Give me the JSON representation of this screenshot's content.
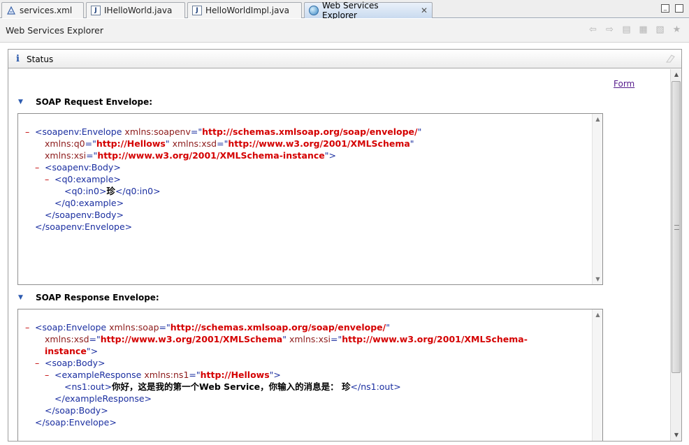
{
  "tabs": [
    {
      "label": "services.xml",
      "icon": "xml-file-icon",
      "active": false
    },
    {
      "label": "IHelloWorld.java",
      "icon": "java-file-icon",
      "active": false
    },
    {
      "label": "HelloWorldImpl.java",
      "icon": "java-file-icon",
      "active": false
    },
    {
      "label": "Web Services Explorer",
      "icon": "globe-icon",
      "active": true
    }
  ],
  "title": "Web Services Explorer",
  "status": {
    "label": "Status",
    "form_link": "Form",
    "request_title": "SOAP Request Envelope:",
    "response_title": "SOAP Response Envelope:"
  },
  "request": {
    "envelope_tag": "soapenv:Envelope",
    "attr_soapenv": "xmlns:soapenv",
    "val_soapenv": "http://schemas.xmlsoap.org/soap/envelope/",
    "attr_q0": "xmlns:q0",
    "val_q0": "http://Hellows",
    "attr_xsd": "xmlns:xsd",
    "val_xsd": "http://www.w3.org/2001/XMLSchema",
    "attr_xsi": "xmlns:xsi",
    "val_xsi": "http://www.w3.org/2001/XMLSchema-instance",
    "body_tag": "soapenv:Body",
    "example_tag": "q0:example",
    "in_tag": "q0:in0",
    "in_value": "珍"
  },
  "response": {
    "envelope_tag": "soap:Envelope",
    "attr_soap": "xmlns:soap",
    "val_soap": "http://schemas.xmlsoap.org/soap/envelope/",
    "attr_xsd": "xmlns:xsd",
    "val_xsd": "http://www.w3.org/2001/XMLSchema",
    "attr_xsi": "xmlns:xsi",
    "val_xsi_1": "http://www.w3.org/2001/XMLSchema-",
    "val_xsi_2": "instance",
    "body_tag": "soap:Body",
    "resp_tag": "exampleResponse",
    "attr_ns1": "xmlns:ns1",
    "val_ns1": "http://Hellows",
    "out_tag": "ns1:out",
    "out_value": "你好，这是我的第一个Web Service，你输入的消息是： 珍"
  },
  "colors": {
    "tag": "#1a2ea0",
    "attr": "#8c1a1a",
    "value": "#d40000"
  }
}
